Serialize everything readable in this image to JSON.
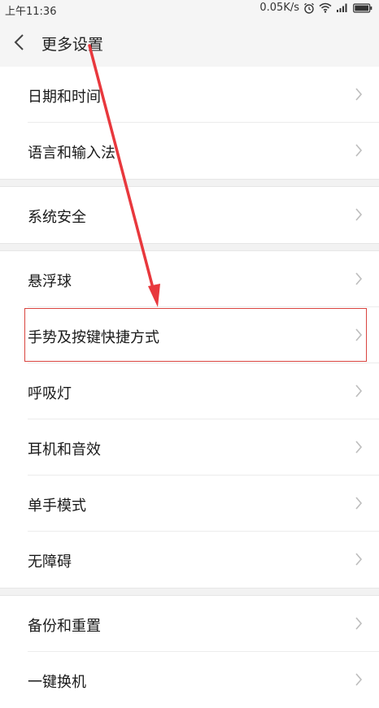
{
  "status_bar": {
    "time": "上午11:36",
    "network_speed": "0.05K/s",
    "icons": [
      "alarm-icon",
      "wifi-icon",
      "signal-icon",
      "battery-icon"
    ]
  },
  "header": {
    "back_icon": "chevron-left-icon",
    "title": "更多设置"
  },
  "groups": [
    {
      "items": [
        {
          "label": "日期和时间"
        },
        {
          "label": "语言和输入法"
        }
      ]
    },
    {
      "items": [
        {
          "label": "系统安全"
        }
      ]
    },
    {
      "items": [
        {
          "label": "悬浮球"
        },
        {
          "label": "手势及按键快捷方式",
          "highlighted": true
        },
        {
          "label": "呼吸灯"
        },
        {
          "label": "耳机和音效"
        },
        {
          "label": "单手模式"
        },
        {
          "label": "无障碍"
        }
      ]
    },
    {
      "items": [
        {
          "label": "备份和重置"
        },
        {
          "label": "一键换机"
        }
      ]
    }
  ],
  "colors": {
    "highlight_border": "#d9443f",
    "annotation_arrow": "#e8383d"
  }
}
